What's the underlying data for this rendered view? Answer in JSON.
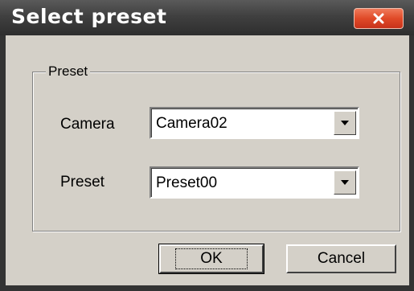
{
  "dialog": {
    "title": "Select preset",
    "close_icon": "close-icon"
  },
  "group": {
    "title": "Preset",
    "camera_label": "Camera",
    "camera_value": "Camera02",
    "preset_label": "Preset",
    "preset_value": "Preset00"
  },
  "buttons": {
    "ok": "OK",
    "cancel": "Cancel"
  },
  "colors": {
    "title_bar": "#404040",
    "dialog_face": "#d4d0c8",
    "close_button": "#e04a28"
  }
}
